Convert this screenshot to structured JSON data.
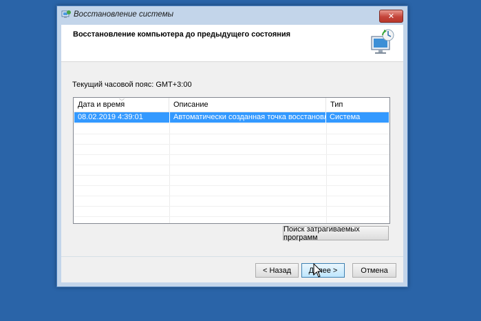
{
  "window": {
    "title": "Восстановление системы",
    "close_label": "✕"
  },
  "header": {
    "title": "Восстановление компьютера до предыдущего состояния"
  },
  "timezone_label": "Текущий часовой пояс: GMT+3:00",
  "table": {
    "columns": [
      "Дата и время",
      "Описание",
      "Тип"
    ],
    "rows": [
      [
        "08.02.2019 4:39:01",
        "Автоматически созданная точка восстановле...",
        "Система"
      ]
    ]
  },
  "buttons": {
    "scan": "Поиск затрагиваемых программ",
    "back": "< Назад",
    "next": "Далее >",
    "cancel": "Отмена"
  },
  "colors": {
    "desktop": "#2a64a8",
    "selection": "#3399ff"
  }
}
